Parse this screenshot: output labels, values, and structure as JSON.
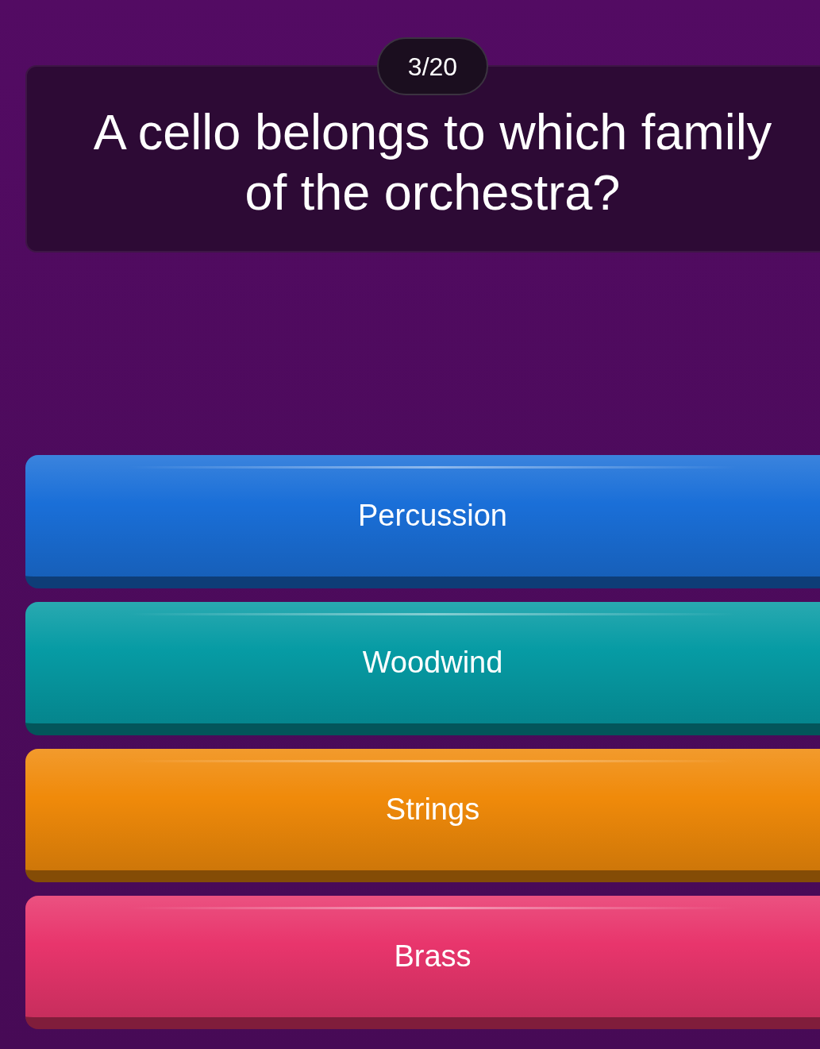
{
  "progress": {
    "counter": "3/20"
  },
  "question": {
    "text": "A cello belongs to which family of the orchestra?"
  },
  "answers": [
    {
      "label": "Percussion",
      "color": "#1a6fd8"
    },
    {
      "label": "Woodwind",
      "color": "#069ba4"
    },
    {
      "label": "Strings",
      "color": "#f08a0a"
    },
    {
      "label": "Brass",
      "color": "#e8356c"
    }
  ]
}
